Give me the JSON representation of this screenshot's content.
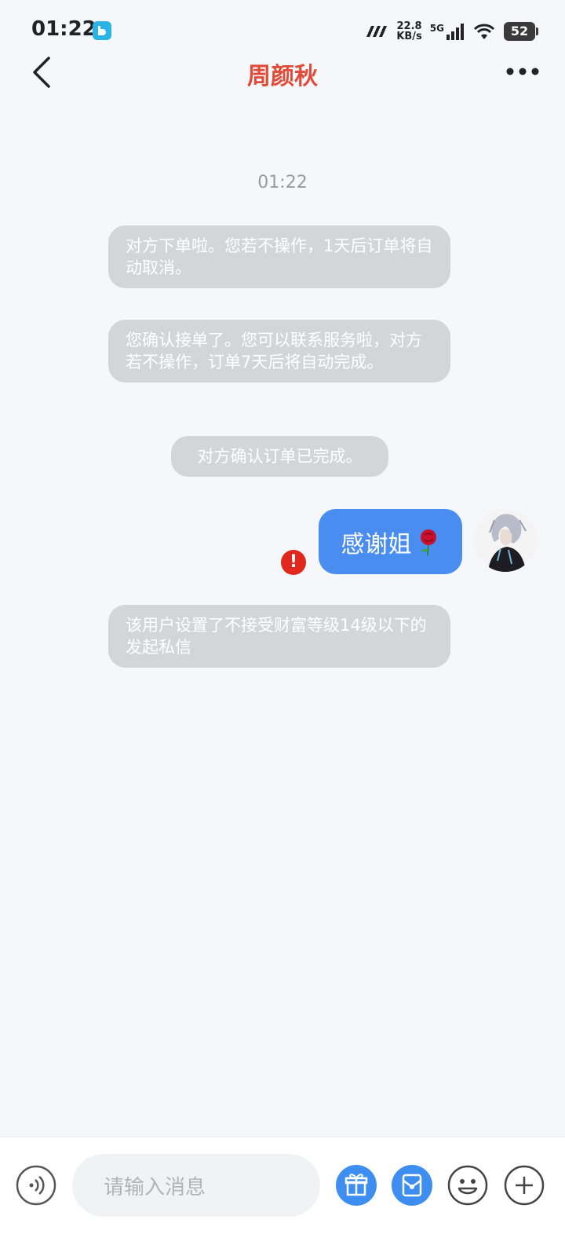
{
  "status_bar": {
    "time": "01:22",
    "net_speed_value": "22.8",
    "net_speed_unit": "KB/s",
    "network": "5G",
    "battery": "52"
  },
  "header": {
    "title": "周颜秋",
    "back_icon": "chevron-left-icon",
    "more_icon": "more-dots-icon"
  },
  "chat": {
    "timestamp": "01:22",
    "system_messages": [
      "对方下单啦。您若不操作，1天后订单将自动取消。",
      "您确认接单了。您可以联系服务啦，对方若不操作，订单7天后将自动完成。",
      "对方确认订单已完成。",
      "该用户设置了不接受财富等级14级以下的发起私信"
    ],
    "my_message": {
      "text": "感谢姐",
      "status": "failed"
    }
  },
  "input_bar": {
    "placeholder": "请输入消息"
  },
  "colors": {
    "title": "#e14c3a",
    "my_bubble": "#4a8df0",
    "system_bubble": "#d3d5d9",
    "error": "#e0281e"
  }
}
